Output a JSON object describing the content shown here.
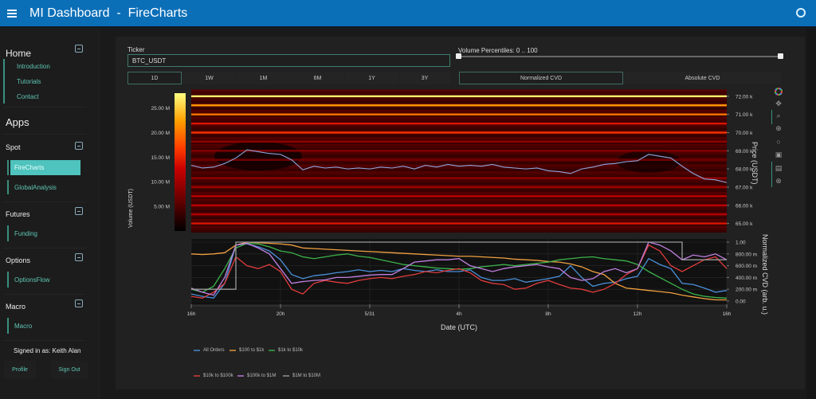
{
  "header": {
    "title": "MI Dashboard  -  FireCharts",
    "menu_icon": "hamburger-menu-icon",
    "status_icon": "circle-icon"
  },
  "sidebar": {
    "sections": [
      {
        "title": "Home",
        "items": [
          "Introduction",
          "Tutorials",
          "Contact"
        ]
      },
      {
        "title": "Apps",
        "items": []
      },
      {
        "title": "Spot",
        "items": [
          "FireCharts",
          "GlobalAnalysis"
        ],
        "active": "FireCharts"
      },
      {
        "title": "Futures",
        "items": [
          "Funding"
        ]
      },
      {
        "title": "Options",
        "items": [
          "OptionsFlow"
        ]
      },
      {
        "title": "Macro",
        "items": [
          "Macro"
        ]
      }
    ],
    "signed_in": "Signed in as: Keith Alan",
    "profile_label": "Profile",
    "signout_label": "Sign Out"
  },
  "controls": {
    "ticker_label": "Ticker",
    "ticker_value": "BTC_USDT",
    "ranges": [
      "1D",
      "1W",
      "1M",
      "6M",
      "1Y",
      "3Y"
    ],
    "active_range": "1D",
    "volume_percentiles_label": "Volume Percentiles: 0 .. 100",
    "volume_percentiles": [
      0,
      100
    ],
    "cvd_modes": [
      "Normalized CVD",
      "Absolute CVD"
    ],
    "active_cvd_mode": "Normalized CVD"
  },
  "modebar": [
    "color-wheel-icon",
    "pan-icon",
    "zoom-icon",
    "zoom-in-out-icon",
    "autoscale-icon",
    "save-icon",
    "compare-icon",
    "reset-icon"
  ],
  "chart_data": [
    {
      "type": "heatmap",
      "title": "",
      "ylabel": "Price (USDT)",
      "ylim": [
        64500,
        72300
      ],
      "yticks": [
        "65.00 k",
        "66.00 k",
        "67.00 k",
        "68.00 k",
        "69.00 k",
        "70.00 k",
        "71.00 k",
        "72.00 k"
      ],
      "ytick_values": [
        65000,
        66000,
        67000,
        68000,
        69000,
        70000,
        71000,
        72000
      ],
      "colorbar": {
        "label": "Volume (USDT)",
        "ticks": [
          "5.00 M",
          "10.00 M",
          "15.00 M",
          "20.00 M",
          "25.00 M"
        ],
        "tick_values": [
          5,
          10,
          15,
          20,
          25
        ],
        "range": [
          0,
          28
        ],
        "colors": [
          "#000000",
          "#5a0000",
          "#c80000",
          "#ff3c00",
          "#ffa000",
          "#ffff80"
        ]
      },
      "volume_bands": [
        {
          "price": 72000,
          "volume": 27
        },
        {
          "price": 71500,
          "volume": 22
        },
        {
          "price": 71000,
          "volume": 20
        },
        {
          "price": 70500,
          "volume": 14
        },
        {
          "price": 70000,
          "volume": 16
        },
        {
          "price": 69500,
          "volume": 9
        },
        {
          "price": 69000,
          "volume": 8
        },
        {
          "price": 68500,
          "volume": 7
        },
        {
          "price": 67500,
          "volume": 9
        },
        {
          "price": 67000,
          "volume": 10
        },
        {
          "price": 66500,
          "volume": 12
        },
        {
          "price": 66000,
          "volume": 12
        },
        {
          "price": 65500,
          "volume": 11
        },
        {
          "price": 65000,
          "volume": 14
        }
      ],
      "price_series": {
        "name": "BTC_USDT Price",
        "color": "#8fa8e0",
        "x": [
          0,
          0.5,
          1,
          1.5,
          2,
          2.5,
          3,
          3.5,
          4,
          4.5,
          5,
          5.5,
          6,
          6.5,
          7,
          7.5,
          8,
          8.5,
          9,
          9.5,
          10,
          10.5,
          11,
          11.5,
          12,
          12.5,
          13,
          13.5,
          14,
          14.5,
          15,
          15.5,
          16,
          16.5,
          17,
          17.5,
          18,
          18.5,
          19,
          19.5,
          20,
          20.5,
          21,
          21.5,
          22,
          22.5,
          23,
          23.5,
          24
        ],
        "y": [
          68200,
          68050,
          68100,
          68300,
          68600,
          69050,
          68950,
          68850,
          68800,
          68500,
          67950,
          68150,
          68050,
          68100,
          68000,
          68050,
          68000,
          68100,
          68050,
          68150,
          68000,
          68200,
          68100,
          68250,
          68150,
          68200,
          68150,
          68250,
          68100,
          68050,
          68000,
          68050,
          67900,
          67850,
          67750,
          68000,
          68100,
          68250,
          68300,
          68400,
          68450,
          68800,
          68700,
          68600,
          68150,
          67750,
          67450,
          67400,
          67250
        ]
      },
      "xlabel": "",
      "legend": "none"
    },
    {
      "type": "line",
      "xlabel": "Date (UTC)",
      "ylabel": "Normalized CVD (arb. u.)",
      "xticks": [
        "16h",
        "20h",
        "5/31",
        "4h",
        "8h",
        "12h",
        "16h"
      ],
      "xtick_values": [
        0,
        4,
        8,
        12,
        16,
        20,
        24
      ],
      "xlim": [
        0,
        24
      ],
      "yticks": [
        "0.00",
        "200.00 m",
        "400.00 m",
        "600.00 m",
        "800.00 m",
        "1.00"
      ],
      "ytick_values": [
        0,
        0.2,
        0.4,
        0.6,
        0.8,
        1.0
      ],
      "ylim": [
        0,
        1
      ],
      "legend": "bottom-left",
      "x": [
        0,
        0.5,
        1,
        1.5,
        2,
        2.5,
        3,
        3.5,
        4,
        4.5,
        5,
        5.5,
        6,
        6.5,
        7,
        7.5,
        8,
        8.5,
        9,
        9.5,
        10,
        10.5,
        11,
        11.5,
        12,
        12.5,
        13,
        13.5,
        14,
        14.5,
        15,
        15.5,
        16,
        16.5,
        17,
        17.5,
        18,
        18.5,
        19,
        19.5,
        20,
        20.5,
        21,
        21.5,
        22,
        22.5,
        23,
        23.5,
        24
      ],
      "series": [
        {
          "name": "All Orders",
          "color": "#4a90d9",
          "values": [
            0.12,
            0.08,
            0.05,
            0.3,
            0.95,
            0.97,
            0.92,
            0.85,
            0.7,
            0.45,
            0.38,
            0.43,
            0.45,
            0.48,
            0.5,
            0.53,
            0.5,
            0.52,
            0.5,
            0.55,
            0.52,
            0.5,
            0.53,
            0.5,
            0.5,
            0.53,
            0.4,
            0.35,
            0.35,
            0.38,
            0.32,
            0.35,
            0.38,
            0.42,
            0.6,
            0.4,
            0.25,
            0.3,
            0.32,
            0.38,
            0.42,
            0.72,
            0.62,
            0.55,
            0.3,
            0.28,
            0.22,
            0.15,
            0.18
          ]
        },
        {
          "name": "$100 to $1k",
          "color": "#f0a040",
          "values": [
            0.8,
            0.79,
            0.8,
            0.82,
            0.95,
            1.0,
            0.99,
            0.98,
            0.97,
            0.95,
            0.9,
            0.89,
            0.88,
            0.87,
            0.86,
            0.85,
            0.84,
            0.83,
            0.82,
            0.81,
            0.8,
            0.79,
            0.78,
            0.77,
            0.76,
            0.76,
            0.75,
            0.74,
            0.73,
            0.71,
            0.7,
            0.69,
            0.67,
            0.66,
            0.63,
            0.58,
            0.5,
            0.45,
            0.3,
            0.22,
            0.2,
            0.18,
            0.16,
            0.14,
            0.1,
            0.07,
            0.04,
            0.02,
            0.02
          ]
        },
        {
          "name": "$1k to $10k",
          "color": "#3cb44b",
          "values": [
            0.2,
            0.15,
            0.25,
            0.55,
            0.9,
            0.98,
            0.97,
            0.92,
            0.85,
            0.82,
            0.75,
            0.72,
            0.75,
            0.78,
            0.8,
            0.76,
            0.74,
            0.7,
            0.66,
            0.62,
            0.6,
            0.58,
            0.56,
            0.55,
            0.54,
            0.55,
            0.58,
            0.6,
            0.62,
            0.6,
            0.62,
            0.64,
            0.66,
            0.7,
            0.72,
            0.74,
            0.75,
            0.72,
            0.7,
            0.68,
            0.62,
            0.5,
            0.4,
            0.3,
            0.2,
            0.12,
            0.08,
            0.06,
            0.05
          ]
        },
        {
          "name": "$10k to $100k",
          "color": "#e03c3c",
          "values": [
            0.08,
            0.05,
            0.15,
            0.3,
            0.75,
            0.6,
            0.55,
            0.62,
            0.5,
            0.2,
            0.12,
            0.3,
            0.35,
            0.32,
            0.3,
            0.35,
            0.38,
            0.4,
            0.38,
            0.42,
            0.45,
            0.5,
            0.48,
            0.52,
            0.55,
            0.48,
            0.35,
            0.3,
            0.28,
            0.2,
            0.22,
            0.3,
            0.35,
            0.28,
            0.22,
            0.2,
            0.15,
            0.2,
            0.3,
            0.45,
            0.55,
            0.95,
            0.85,
            0.6,
            0.5,
            0.6,
            0.7,
            0.75,
            0.55
          ]
        },
        {
          "name": "$100k to $1M",
          "color": "#c080e0",
          "values": [
            0.22,
            0.15,
            0.1,
            0.4,
            0.95,
            0.98,
            0.9,
            0.8,
            0.55,
            0.3,
            0.33,
            0.35,
            0.36,
            0.4,
            0.4,
            0.42,
            0.44,
            0.45,
            0.45,
            0.55,
            0.66,
            0.68,
            0.7,
            0.7,
            0.72,
            0.6,
            0.55,
            0.5,
            0.55,
            0.58,
            0.6,
            0.62,
            0.58,
            0.55,
            0.4,
            0.35,
            0.38,
            0.5,
            0.55,
            0.48,
            0.55,
            1.0,
            0.95,
            0.85,
            0.7,
            0.78,
            0.75,
            0.8,
            0.7
          ]
        },
        {
          "name": "$1M to $10M",
          "color": "#9a9a9a",
          "values": [
            0.2,
            0.2,
            0.2,
            0.2,
            1.0,
            1.0,
            1.0,
            1.0,
            1.0,
            1.0,
            1.0,
            1.0,
            1.0,
            1.0,
            1.0,
            1.0,
            1.0,
            1.0,
            1.0,
            1.0,
            1.0,
            1.0,
            1.0,
            1.0,
            1.0,
            1.0,
            1.0,
            1.0,
            1.0,
            1.0,
            1.0,
            1.0,
            1.0,
            1.0,
            1.0,
            1.0,
            1.0,
            1.0,
            1.0,
            1.0,
            1.0,
            1.0,
            1.0,
            1.0,
            0.7,
            0.7,
            0.7,
            0.7,
            0.7
          ]
        }
      ]
    }
  ]
}
